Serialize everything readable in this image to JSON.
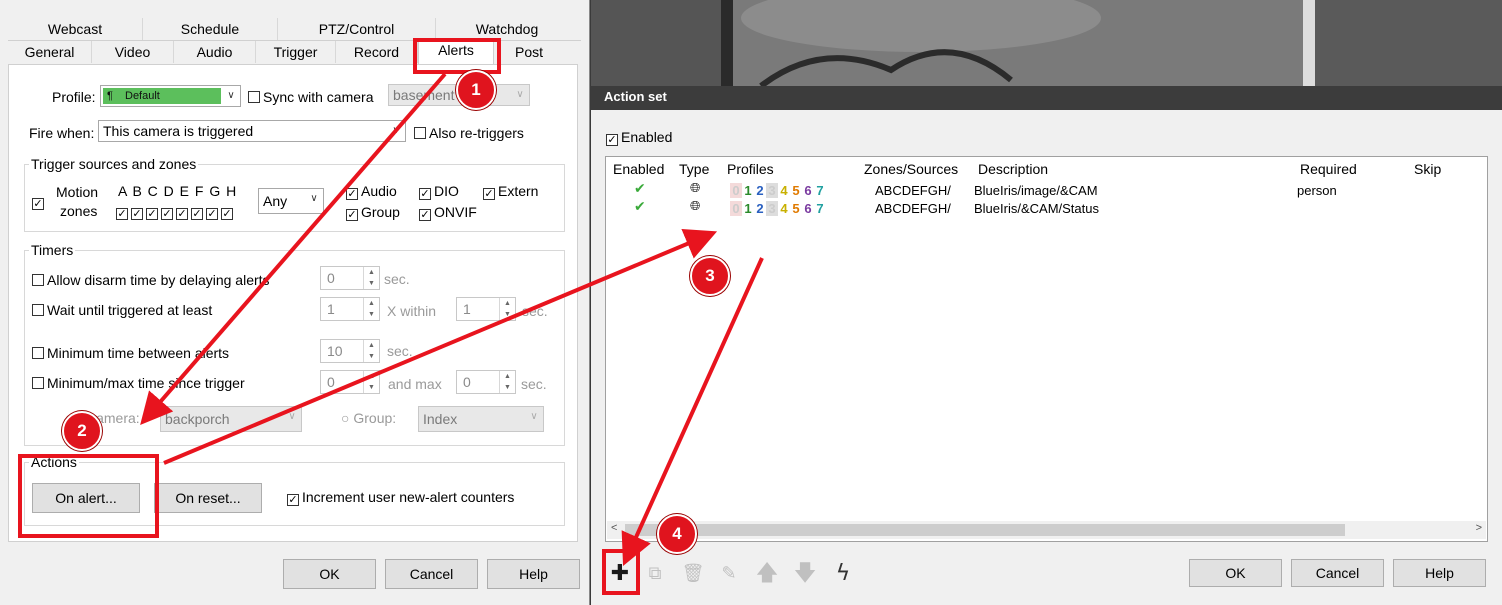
{
  "left_dialog": {
    "tabs_top": [
      "Webcast",
      "Schedule",
      "PTZ/Control",
      "Watchdog"
    ],
    "tabs_bottom": [
      "General",
      "Video",
      "Audio",
      "Trigger",
      "Record",
      "Alerts",
      "Post"
    ],
    "profile_label": "Profile:",
    "profile_value": "Default",
    "sync_label": "Sync with camera",
    "sync_camera_value": "basement",
    "fire_when_label": "Fire when:",
    "fire_when_value": "This camera is triggered",
    "also_retriggers": "Also re-triggers",
    "trigger_group_title": "Trigger sources and zones",
    "motion_label": "Motion",
    "zones_label": "zones",
    "zone_letters": "A B C D E F G H",
    "zone_any": "Any",
    "audio": "Audio",
    "dio": "DIO",
    "extern": "Extern",
    "group": "Group",
    "onvif": "ONVIF",
    "timers_title": "Timers",
    "allow_disarm": "Allow disarm time by delaying alerts",
    "allow_disarm_value": "0",
    "wait_until": "Wait until triggered at least",
    "wait_value": "1",
    "x_within": "X within",
    "within_value": "1",
    "min_between": "Minimum time between alerts",
    "min_between_value": "10",
    "min_max": "Minimum/max time since trigger",
    "min_value": "0",
    "and_max": "and max",
    "max_value": "0",
    "sec": "sec.",
    "camera_label": "Camera:",
    "camera_value": "backporch",
    "group_label": "Group:",
    "group_value": "Index",
    "actions_title": "Actions",
    "on_alert": "On alert...",
    "on_reset": "On reset...",
    "increment": "Increment user new-alert counters",
    "ok": "OK",
    "cancel": "Cancel",
    "help": "Help"
  },
  "action_set": {
    "title": "Action set",
    "enabled_label": "Enabled",
    "columns": [
      "Enabled",
      "Type",
      "Profiles",
      "Zones/Sources",
      "Description",
      "Required",
      "Skip"
    ],
    "rows": [
      {
        "profiles": "01234567",
        "zones": "ABCDEFGH/",
        "description": "BlueIris/image/&CAM",
        "required": "person"
      },
      {
        "profiles": "01234567",
        "zones": "ABCDEFGH/",
        "description": "BlueIris/&CAM/Status",
        "required": ""
      }
    ],
    "ok": "OK",
    "cancel": "Cancel",
    "help": "Help"
  },
  "annotations": [
    "1",
    "2",
    "3",
    "4"
  ],
  "colors": {
    "accent_red": "#e8141e",
    "profile_green": "#5cbf5c"
  }
}
